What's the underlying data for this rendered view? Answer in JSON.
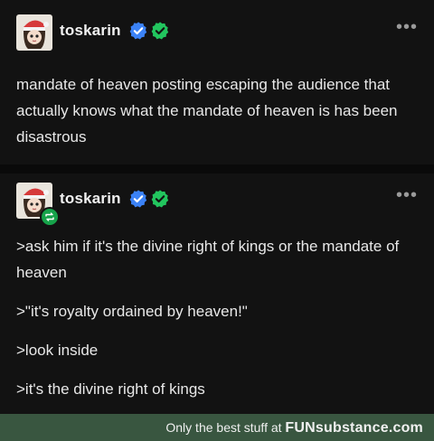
{
  "post1": {
    "username": "toskarin",
    "more_label": "•••",
    "body": "mandate of heaven posting escaping the audience that actually knows what the mandate of heaven is has been disastrous"
  },
  "post2": {
    "username": "toskarin",
    "more_label": "•••",
    "lines": [
      ">ask him if it's the divine right of kings or the mandate of heaven",
      ">\"it's royalty ordained by heaven!\"",
      ">look inside",
      ">it's the divine right of kings"
    ]
  },
  "footer": {
    "text": "Only the best stuff at",
    "brand": "FUNsubstance.com"
  },
  "colors": {
    "background": "#121212",
    "verified_blue": "#3b82f6",
    "verified_green": "#22c55e",
    "footer_bg": "#395640"
  }
}
